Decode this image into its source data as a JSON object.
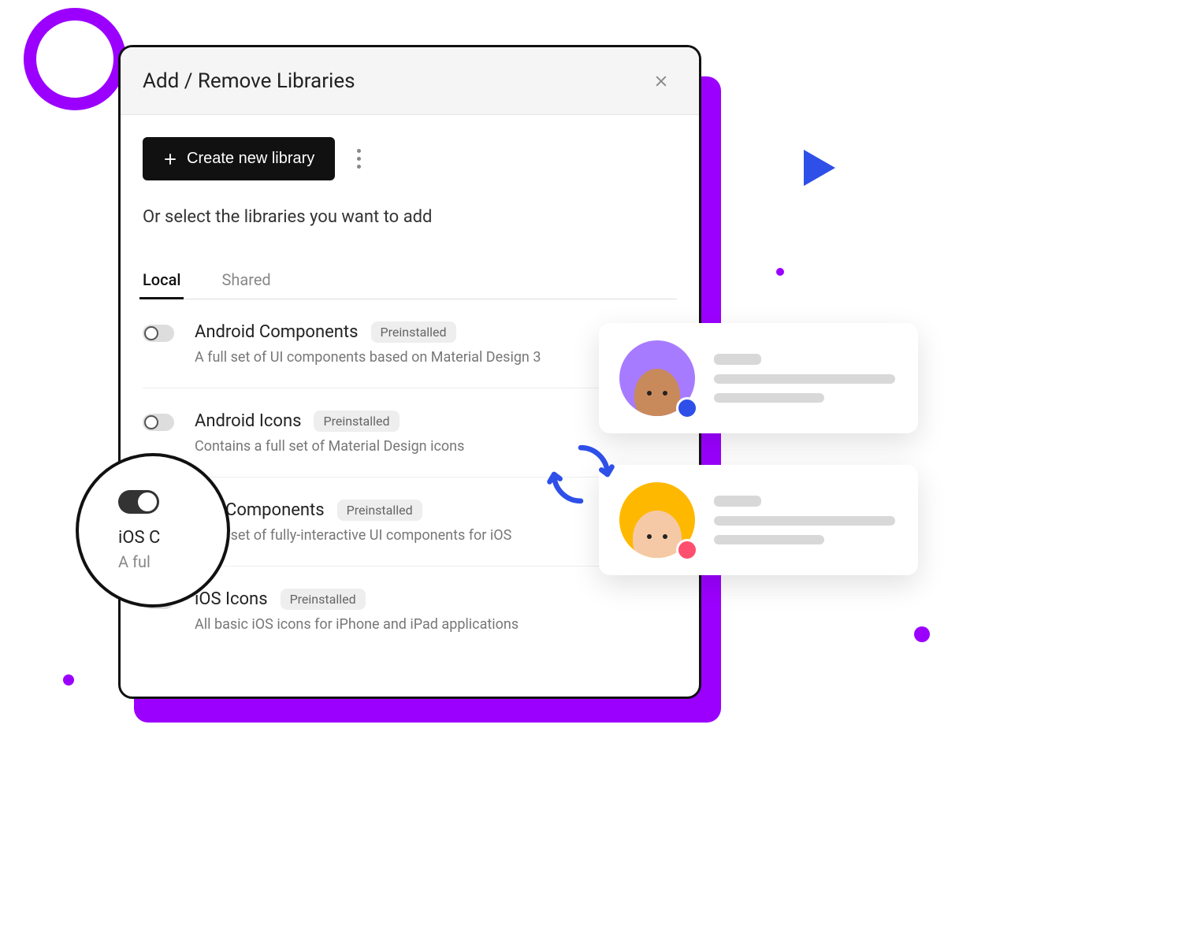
{
  "modal": {
    "title": "Add / Remove Libraries",
    "create_button": "Create new library",
    "hint": "Or select the libraries you want to add",
    "tabs": {
      "local": "Local",
      "shared": "Shared"
    },
    "libraries": [
      {
        "name": "Android Components",
        "badge": "Preinstalled",
        "desc": "A full set of UI components based on Material Design 3",
        "enabled": false
      },
      {
        "name": "Android Icons",
        "badge": "Preinstalled",
        "desc": "Contains a full set of Material Design icons",
        "enabled": false
      },
      {
        "name": "iOS Components",
        "badge": "Preinstalled",
        "desc": "A full set of fully-interactive UI components for iOS",
        "enabled": true
      },
      {
        "name": "iOS Icons",
        "badge": "Preinstalled",
        "desc": "All basic iOS icons for iPhone and iPad applications",
        "enabled": false
      }
    ]
  },
  "magnifier": {
    "title": "iOS C",
    "sub": "A ful"
  },
  "colors": {
    "accent": "#9B00FF",
    "blue": "#2E4FE8",
    "pink": "#FF4F6E"
  }
}
